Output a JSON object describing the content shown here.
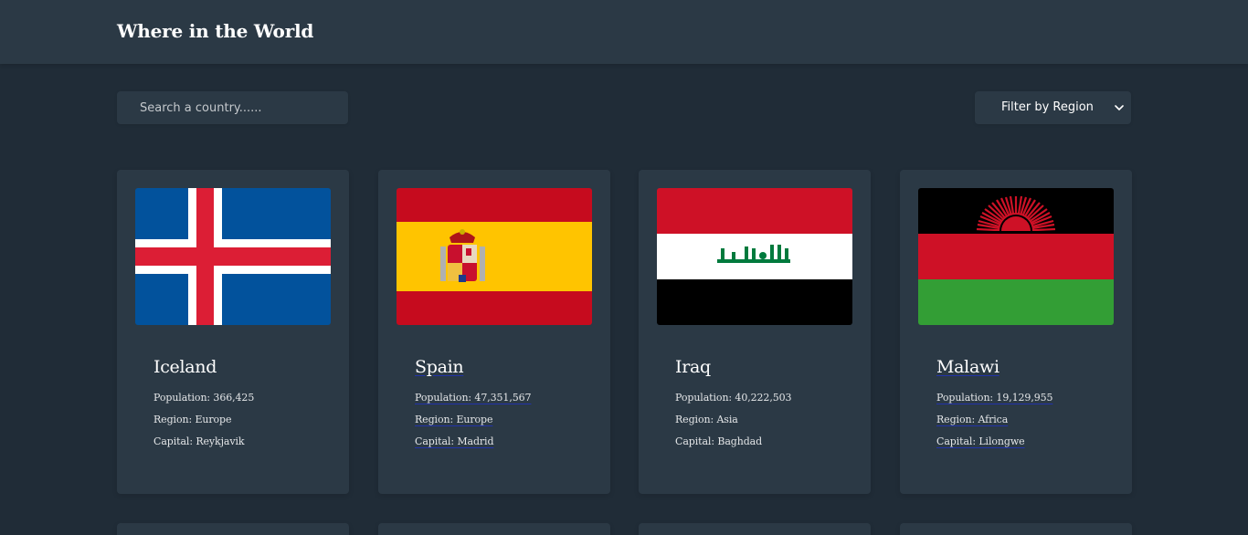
{
  "header": {
    "title": "Where in the World"
  },
  "search": {
    "placeholder": "Search a country......",
    "value": ""
  },
  "filter": {
    "label": "Filter by Region",
    "icon": "chevron-down-icon"
  },
  "countries": [
    {
      "name": "Iceland",
      "population": "Population: 366,425",
      "region": "Region: Europe",
      "capital": "Capital: Reykjavik",
      "flag": "iceland-flag"
    },
    {
      "name": "Spain",
      "population": "Population: 47,351,567",
      "region": "Region: Europe",
      "capital": "Capital: Madrid",
      "flag": "spain-flag"
    },
    {
      "name": "Iraq",
      "population": "Population: 40,222,503",
      "region": "Region: Asia",
      "capital": "Capital: Baghdad",
      "flag": "iraq-flag"
    },
    {
      "name": "Malawi",
      "population": "Population: 19,129,955",
      "region": "Region: Africa",
      "capital": "Capital: Lilongwe",
      "flag": "malawi-flag"
    }
  ],
  "colors": {
    "background": "#202c37",
    "surface": "#2b3945",
    "text": "#ffffff"
  }
}
